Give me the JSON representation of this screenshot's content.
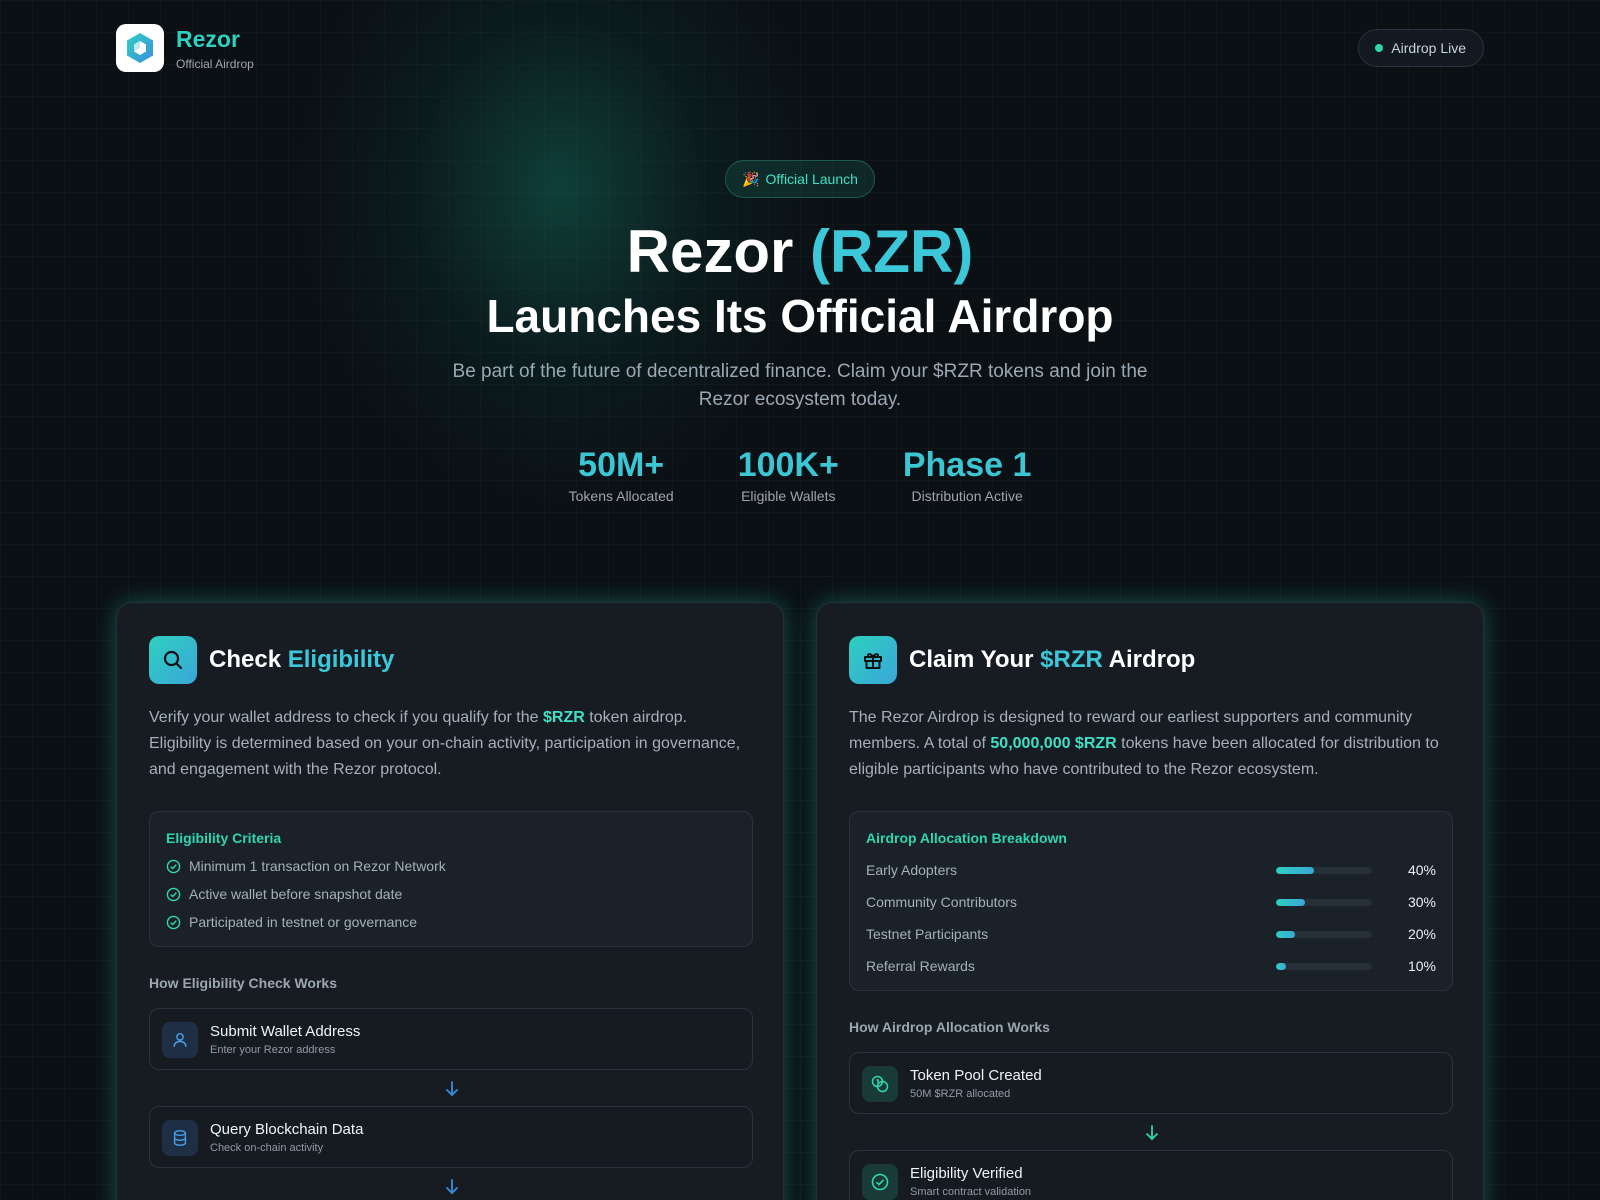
{
  "header": {
    "brand_name": "Rezor",
    "brand_sub": "Official Airdrop",
    "live_label": "Airdrop Live"
  },
  "hero": {
    "badge_emoji": "🎉",
    "badge_label": "Official Launch",
    "title_main": "Rezor",
    "title_accent": "(RZR)",
    "subtitle": "Launches Its Official Airdrop",
    "description": "Be part of the future of decentralized finance. Claim your $RZR tokens and join the Rezor ecosystem today.",
    "stats": [
      {
        "value": "50M+",
        "label": "Tokens Allocated"
      },
      {
        "value": "100K+",
        "label": "Eligible Wallets"
      },
      {
        "value": "Phase 1",
        "label": "Distribution Active"
      }
    ]
  },
  "eligibility": {
    "title_main": "Check",
    "title_accent": "Eligibility",
    "desc_part1": "Verify your wallet address to check if you qualify for the",
    "desc_highlight": "$RZR",
    "desc_part2": "token airdrop. Eligibility is determined based on your on-chain activity, participation in governance, and engagement with the Rezor protocol.",
    "criteria_title": "Eligibility Criteria",
    "criteria": [
      "Minimum 1 transaction on Rezor Network",
      "Active wallet before snapshot date",
      "Participated in testnet or governance"
    ],
    "how_label": "How Eligibility Check Works",
    "steps": [
      {
        "title": "Submit Wallet Address",
        "sub": "Enter your Rezor address",
        "icon": "user-icon"
      },
      {
        "title": "Query Blockchain Data",
        "sub": "Check on-chain activity",
        "icon": "database-icon"
      }
    ]
  },
  "claim": {
    "title_main": "Claim Your",
    "title_accent": "$RZR",
    "title_end": "Airdrop",
    "desc_part1": "The Rezor Airdrop is designed to reward our earliest supporters and community members. A total of",
    "desc_highlight": "50,000,000 $RZR",
    "desc_part2": "tokens have been allocated for distribution to eligible participants who have contributed to the Rezor ecosystem.",
    "alloc_title": "Airdrop Allocation Breakdown",
    "allocations": [
      {
        "label": "Early Adopters",
        "percent": 40,
        "pct_label": "40%"
      },
      {
        "label": "Community Contributors",
        "percent": 30,
        "pct_label": "30%"
      },
      {
        "label": "Testnet Participants",
        "percent": 20,
        "pct_label": "20%"
      },
      {
        "label": "Referral Rewards",
        "percent": 10,
        "pct_label": "10%"
      }
    ],
    "how_label": "How Airdrop Allocation Works",
    "steps": [
      {
        "title": "Token Pool Created",
        "sub": "50M $RZR allocated",
        "icon": "coins-icon"
      },
      {
        "title": "Eligibility Verified",
        "sub": "Smart contract validation",
        "icon": "check-circle-icon"
      }
    ]
  },
  "colors": {
    "accent_teal": "#2fd0c0",
    "accent_blue": "#3aa6d8",
    "highlight_green": "#3fe0c6",
    "background": "#0b1014",
    "card": "#171c23"
  }
}
